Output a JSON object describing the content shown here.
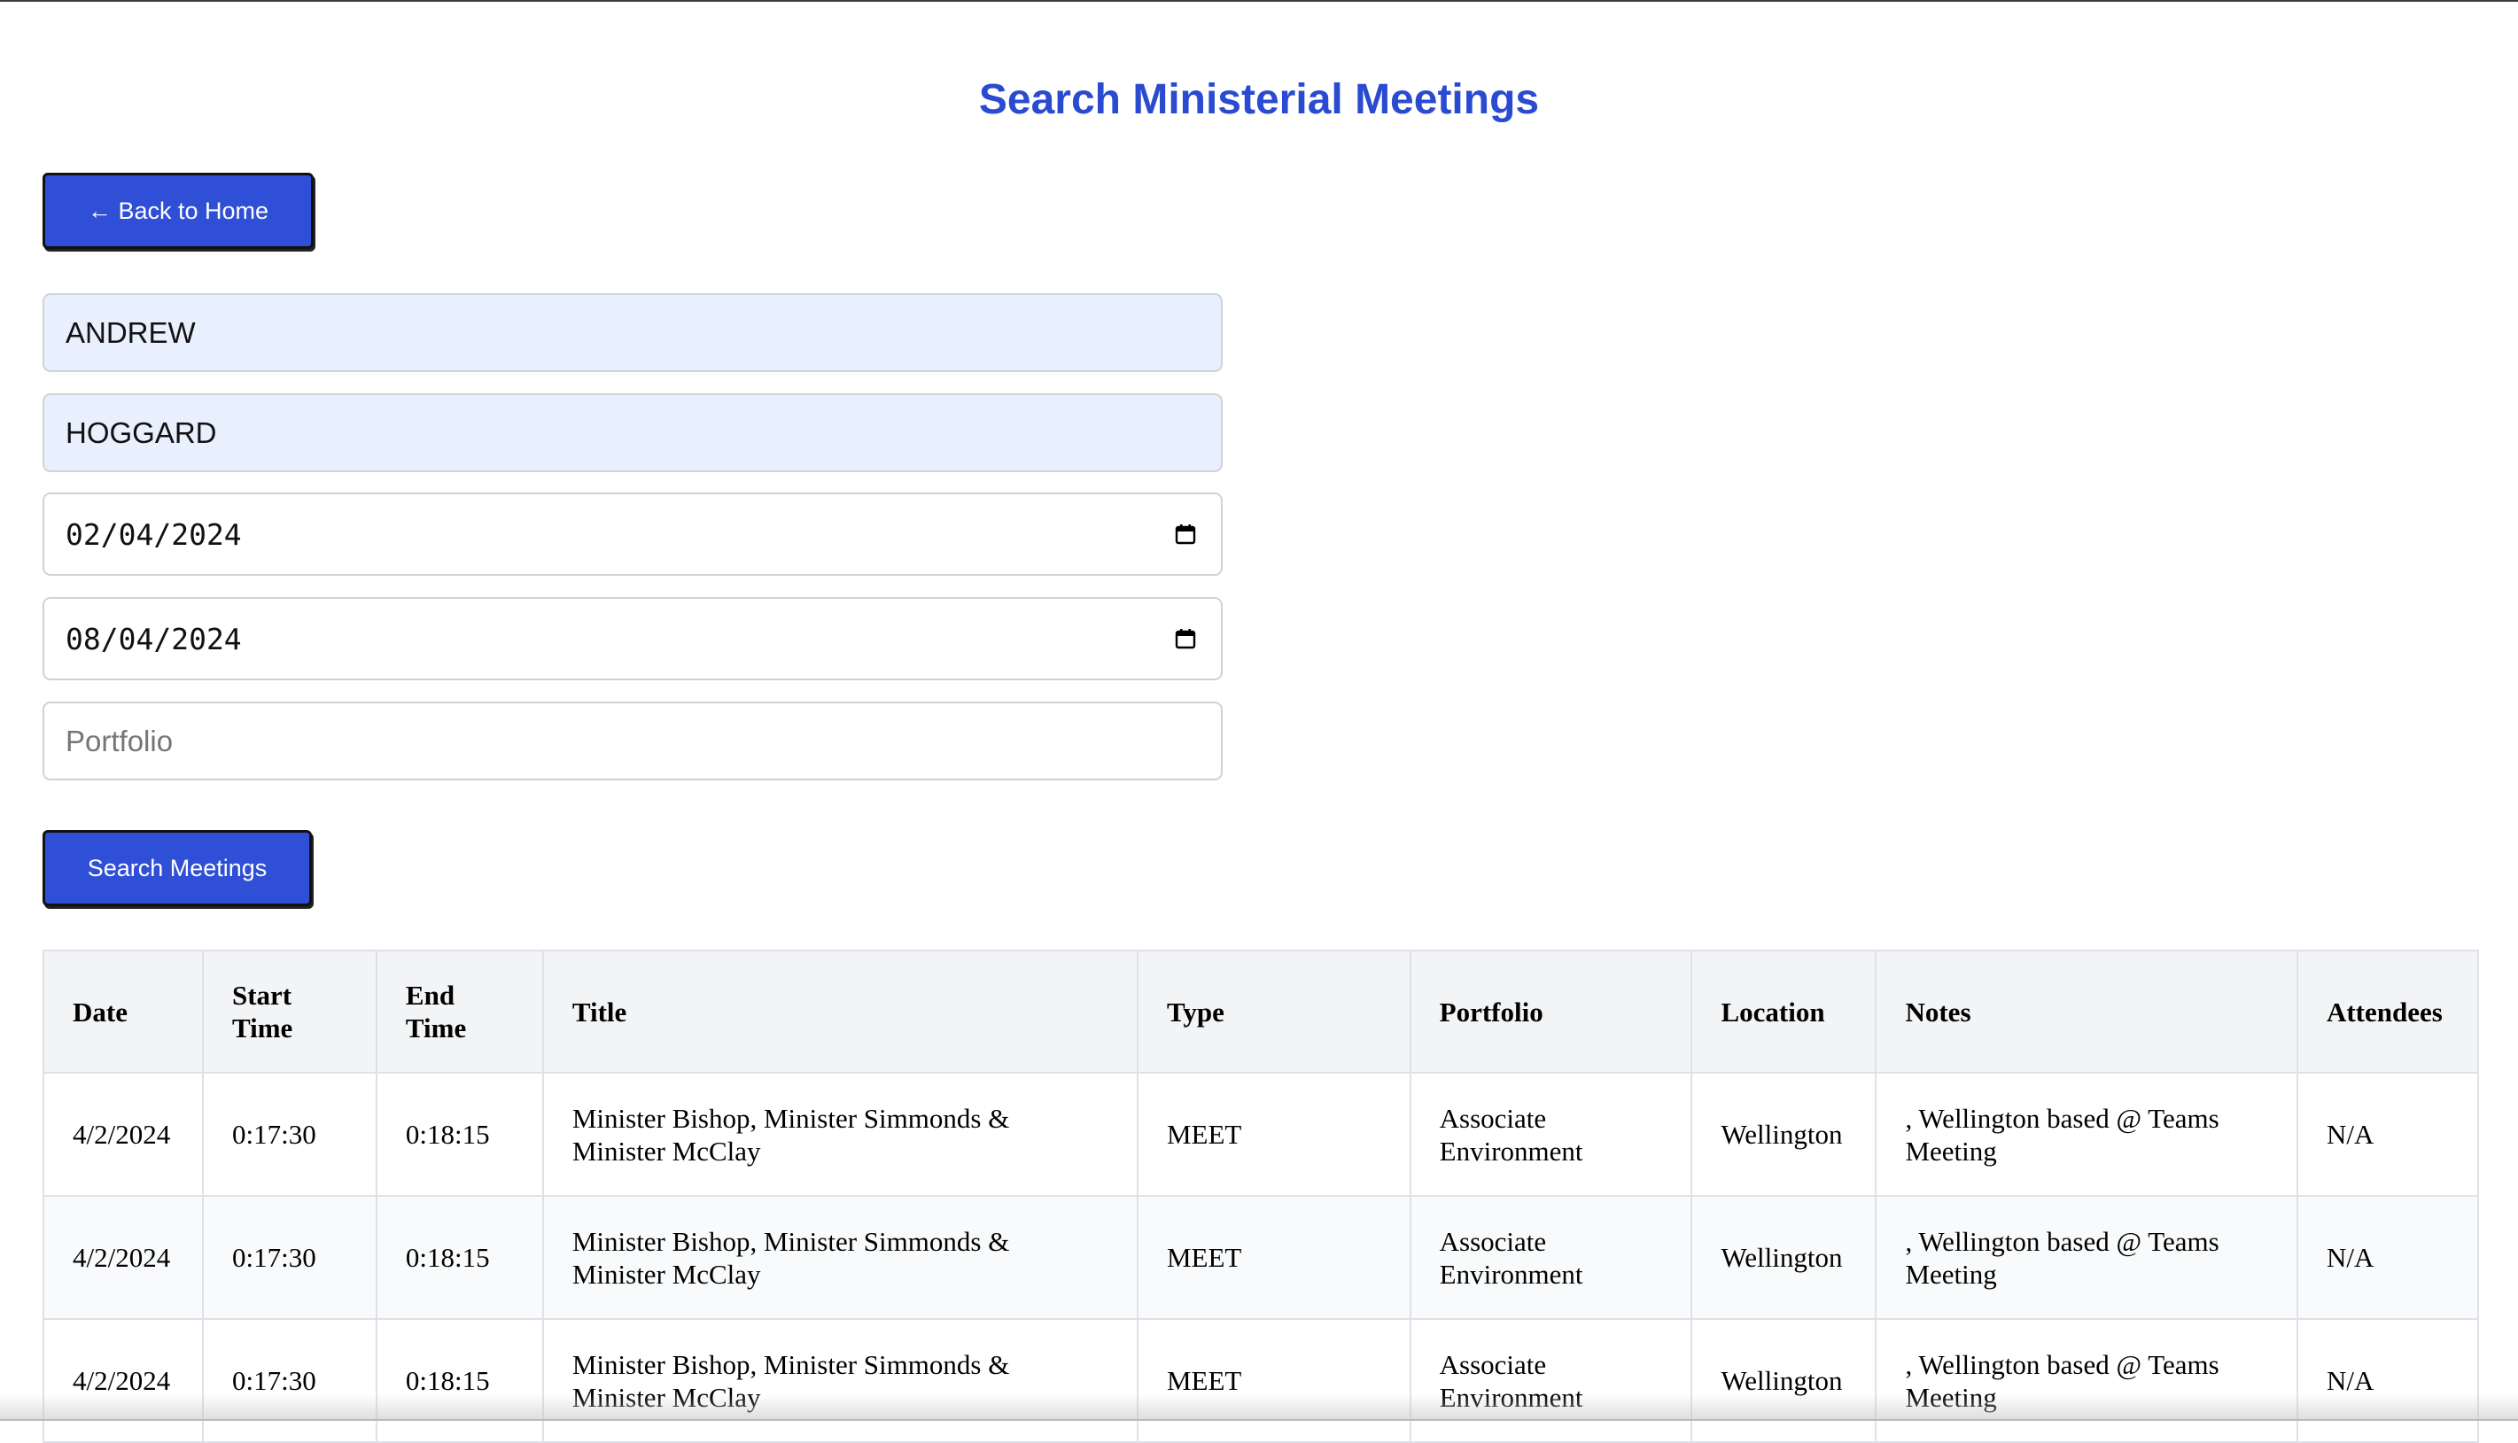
{
  "page": {
    "title": "Search Ministerial Meetings"
  },
  "back_button": {
    "label": "← Back to Home"
  },
  "form": {
    "first_name": "ANDREW",
    "last_name": "HOGGARD",
    "start_date": "02/04/2024",
    "end_date": "08/04/2024",
    "portfolio_placeholder": "Portfolio",
    "search_label": "Search Meetings"
  },
  "table": {
    "headers": [
      "Date",
      "Start Time",
      "End Time",
      "Title",
      "Type",
      "Portfolio",
      "Location",
      "Notes",
      "Attendees"
    ],
    "rows": [
      [
        "4/2/2024",
        "0:17:30",
        "0:18:15",
        "Minister Bishop, Minister Simmonds & Minister McClay",
        "MEET",
        "Associate Environment",
        "Wellington",
        ", Wellington based @ Teams Meeting",
        "N/A"
      ],
      [
        "4/2/2024",
        "0:17:30",
        "0:18:15",
        "Minister Bishop, Minister Simmonds & Minister McClay",
        "MEET",
        "Associate Environment",
        "Wellington",
        ", Wellington based @ Teams Meeting",
        "N/A"
      ],
      [
        "4/2/2024",
        "0:17:30",
        "0:18:15",
        "Minister Bishop, Minister Simmonds & Minister McClay",
        "MEET",
        "Associate Environment",
        "Wellington",
        ", Wellington based @ Teams Meeting",
        "N/A"
      ]
    ]
  },
  "icons": {
    "date_picker": "calendar-icon"
  },
  "colors": {
    "accent": "#2f4fd6",
    "title": "#2a4bd1",
    "autofill": "#e8f0fe"
  }
}
